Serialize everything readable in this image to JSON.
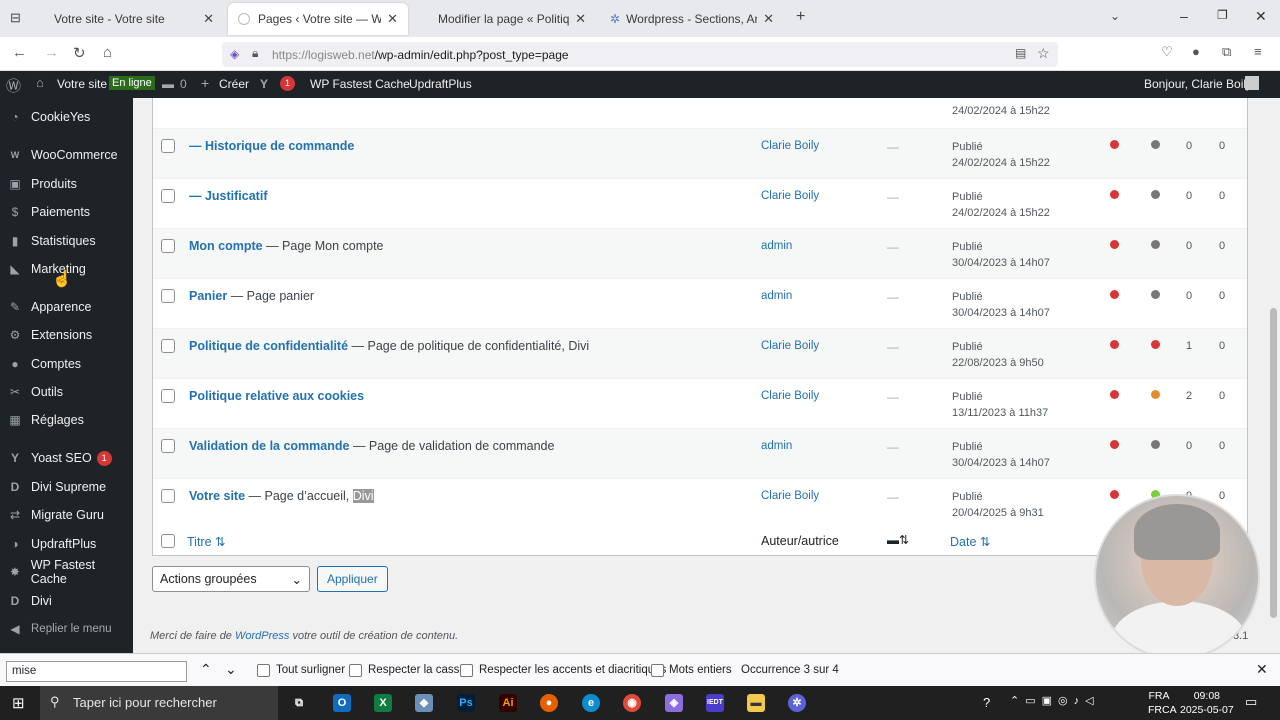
{
  "browser": {
    "tabs": [
      {
        "title": "Votre site - Votre site",
        "active": false
      },
      {
        "title": "Pages ‹ Votre site — WordPress",
        "active": true
      },
      {
        "title": "Modifier la page « Politique rel…",
        "active": false
      },
      {
        "title": "Wordpress - Sections, Articles,",
        "active": false
      }
    ],
    "url_host": "https://logisweb.net",
    "url_path": "/wp-admin/edit.php?post_type=page"
  },
  "adminbar": {
    "site": "Votre site",
    "online": "En ligne",
    "comments": "0",
    "create": "Créer",
    "yoast_count": "1",
    "fastest": "WP Fastest Cache",
    "updraft": "UpdraftPlus",
    "greeting": "Bonjour, Clarie Boily"
  },
  "sidebar": [
    {
      "label": "CookieYes",
      "icon": "cookie-icon"
    },
    {
      "label": "WooCommerce",
      "icon": "woo-icon"
    },
    {
      "label": "Produits",
      "icon": "archive-icon"
    },
    {
      "label": "Paiements",
      "icon": "money-icon"
    },
    {
      "label": "Statistiques",
      "icon": "chart-icon"
    },
    {
      "label": "Marketing",
      "icon": "megaphone-icon"
    },
    {
      "label": "Apparence",
      "icon": "brush-icon"
    },
    {
      "label": "Extensions",
      "icon": "plugin-icon"
    },
    {
      "label": "Comptes",
      "icon": "user-icon"
    },
    {
      "label": "Outils",
      "icon": "wrench-icon"
    },
    {
      "label": "Réglages",
      "icon": "settings-icon"
    },
    {
      "label": "Yoast SEO",
      "icon": "yoast-icon",
      "badge": "1"
    },
    {
      "label": "Divi Supreme",
      "icon": "divi-supreme-icon"
    },
    {
      "label": "Migrate Guru",
      "icon": "migrate-icon"
    },
    {
      "label": "UpdraftPlus",
      "icon": "updraft-icon"
    },
    {
      "label": "WP Fastest Cache",
      "icon": "cheetah-icon"
    },
    {
      "label": "Divi",
      "icon": "divi-icon"
    },
    {
      "label": "Replier le menu",
      "icon": "collapse-icon"
    }
  ],
  "partial_row": {
    "date": "24/02/2024 à 15h22"
  },
  "rows": [
    {
      "title": "— Historique de commande",
      "suffix": "",
      "author": "Clarie Boily",
      "status": "Publié",
      "date": "24/02/2024 à 15h22",
      "seo": "#d63638",
      "read": "#777777",
      "links": "0",
      "linked": "0"
    },
    {
      "title": "— Justificatif",
      "suffix": "",
      "author": "Clarie Boily",
      "status": "Publié",
      "date": "24/02/2024 à 15h22",
      "seo": "#d63638",
      "read": "#777777",
      "links": "0",
      "linked": "0"
    },
    {
      "title": "Mon compte",
      "suffix": " — Page Mon compte",
      "author": "admin",
      "status": "Publié",
      "date": "30/04/2023 à 14h07",
      "seo": "#d63638",
      "read": "#777777",
      "links": "0",
      "linked": "0"
    },
    {
      "title": "Panier",
      "suffix": " — Page panier",
      "author": "admin",
      "status": "Publié",
      "date": "30/04/2023 à 14h07",
      "seo": "#d63638",
      "read": "#777777",
      "links": "0",
      "linked": "0"
    },
    {
      "title": "Politique de confidentialité",
      "suffix": " — Page de politique de confidentialité, Divi",
      "author": "Clarie Boily",
      "status": "Publié",
      "date": "22/08/2023 à 9h50",
      "seo": "#d63638",
      "read": "#d63638",
      "links": "1",
      "linked": "0"
    },
    {
      "title": "Politique relative aux cookies",
      "suffix": "",
      "author": "Clarie Boily",
      "status": "Publié",
      "date": "13/11/2023 à 11h37",
      "seo": "#d63638",
      "read": "#e68a2e",
      "links": "2",
      "linked": "0"
    },
    {
      "title": "Validation de la commande",
      "suffix": " — Page de validation de commande",
      "author": "admin",
      "status": "Publié",
      "date": "30/04/2023 à 14h07",
      "seo": "#d63638",
      "read": "#777777",
      "links": "0",
      "linked": "0"
    },
    {
      "title": "Votre site",
      "suffix": " — Page d’accueil, ",
      "highlight": "Divi",
      "author": "Clarie Boily",
      "status": "Publié",
      "date": "20/04/2025 à 9h31",
      "seo": "#d63638",
      "read": "#7ad03a",
      "links": "9",
      "linked": "0"
    }
  ],
  "footer": {
    "title": "Titre",
    "author": "Auteur/autrice",
    "date": "Date"
  },
  "bulk": {
    "select": "Actions groupées",
    "apply": "Appliquer"
  },
  "thanks": {
    "pre": "Merci de faire de ",
    "link": "WordPress",
    "post": " votre outil de création de contenu.",
    "version": "3.1"
  },
  "findbar": {
    "query": "mise",
    "opt1": "Tout surligner",
    "opt2": "Respecter la casse",
    "opt3": "Respecter les accents et diacritiques",
    "opt4": "Mots entiers",
    "result": "Occurrence 3 sur 4"
  },
  "taskbar": {
    "search": "Taper ici pour rechercher",
    "lang1": "FRA",
    "lang2": "FRCA",
    "time": "09:08",
    "date": "2025-05-07"
  }
}
